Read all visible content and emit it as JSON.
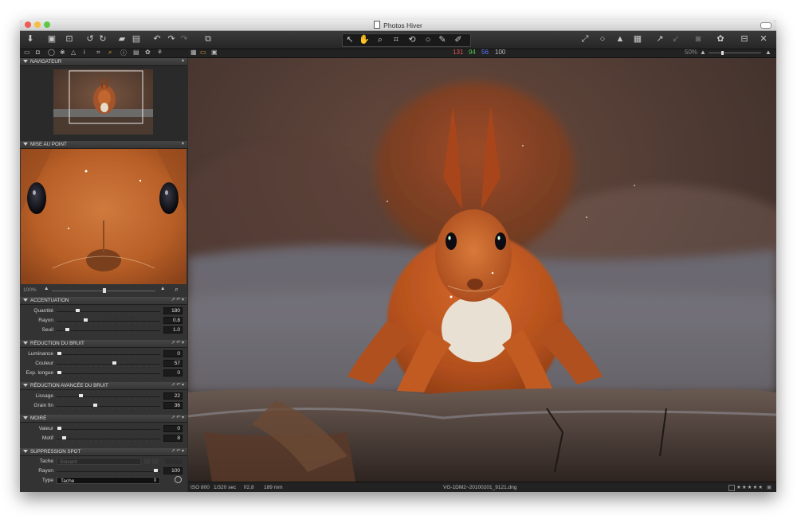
{
  "window": {
    "title": "Photos Hiver"
  },
  "toolbar": {
    "left_icons": [
      "import-icon",
      "capture-icon",
      "export-icon",
      "rotate-left-icon",
      "rotate-right-icon",
      "move-to-folder-icon",
      "trash-icon",
      "undo-icon",
      "redo-icon",
      "redo-icon",
      "variants-icon"
    ],
    "center_icons": [
      "select-cursor-icon",
      "pan-hand-icon",
      "zoom-icon",
      "crop-icon",
      "rotate-tool-icon",
      "spot-icon",
      "picker-icon",
      "brush-icon"
    ],
    "right_icons": [
      "fullscreen-icon",
      "search-icon",
      "warning-icon",
      "grid-icon",
      "cursor-arrow-icon",
      "brush-off-icon",
      "camera-icon",
      "settings-icon",
      "compare-icon",
      "tools-icon"
    ]
  },
  "subbar": {
    "rgb": {
      "r": "131",
      "g": "94",
      "b": "56",
      "l": "100"
    },
    "zoom": "50%",
    "colors": {
      "r": "#e05050",
      "g": "#4fc04f",
      "b": "#5b7bff",
      "l": "#bbbbbb"
    }
  },
  "sidebar": {
    "navigator": {
      "title": "NAVIGATEUR"
    },
    "focus": {
      "title": "MISE AU POINT",
      "zoom": "100%"
    },
    "sharpening": {
      "title": "ACCENTUATION",
      "rows": [
        {
          "label": "Quantité",
          "value": "180"
        },
        {
          "label": "Rayon",
          "value": "0.8"
        },
        {
          "label": "Seuil",
          "value": "1.0"
        }
      ]
    },
    "noise": {
      "title": "RÉDUCTION DU BRUIT",
      "rows": [
        {
          "label": "Luminance",
          "value": "0"
        },
        {
          "label": "Couleur",
          "value": "57"
        },
        {
          "label": "Exp. longue",
          "value": "0"
        }
      ]
    },
    "advnoise": {
      "title": "RÉDUCTION AVANCÉE DU BRUIT",
      "rows": [
        {
          "label": "Lissage",
          "value": "22"
        },
        {
          "label": "Grain fin",
          "value": "36"
        }
      ]
    },
    "moire": {
      "title": "MOIRÉ",
      "rows": [
        {
          "label": "Valeur",
          "value": "0"
        },
        {
          "label": "Motif",
          "value": "8"
        }
      ]
    },
    "spot": {
      "title": "SUPPRESSION SPOT",
      "tache_label": "Tache",
      "tache_value": "Soixant",
      "rayon_label": "Rayon",
      "rayon_value": "100",
      "type_label": "Type",
      "type_value": "Tache"
    }
  },
  "status": {
    "iso": "ISO 800",
    "shutter": "1/320 sec",
    "aperture": "f/2,8",
    "focal": "189 mm",
    "filename": "VG-1DM2~20100201_9121.dng",
    "rating": "★★★★★"
  }
}
